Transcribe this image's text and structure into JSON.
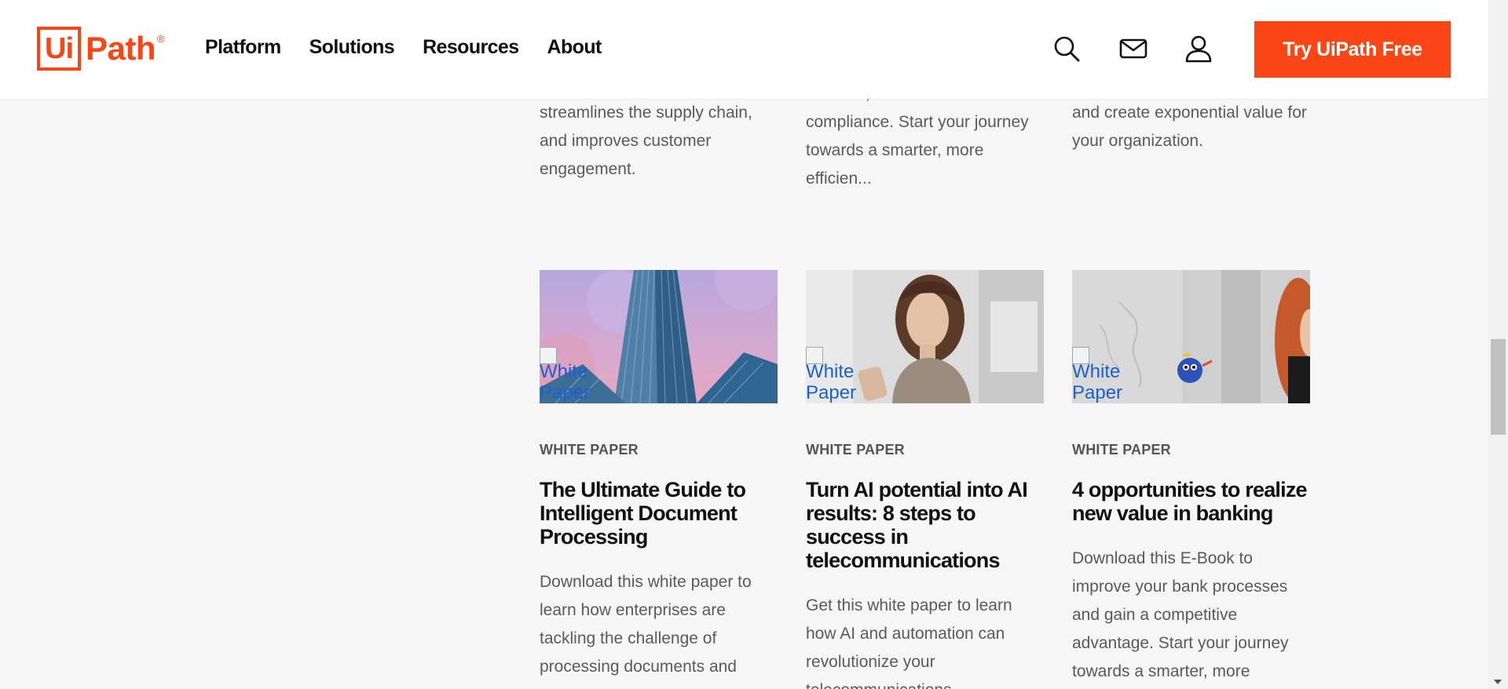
{
  "header": {
    "logo": {
      "brand": "Ui",
      "suffix": "Path",
      "reg": "®"
    },
    "nav": [
      "Platform",
      "Solutions",
      "Resources",
      "About"
    ],
    "icons": [
      "search-icon",
      "mail-icon",
      "user-icon"
    ],
    "cta_label": "Try UiPath Free"
  },
  "colors": {
    "accent": "#fa4616",
    "link": "#1a5fd0"
  },
  "top_texts": [
    "streamlines the supply chain, and improves customer engagement.",
    "revenue, and ensure compliance. Start your journey towards a smarter, more efficien...",
    "and create exponential value for your organization."
  ],
  "cards": [
    {
      "image_alt": "White Paper",
      "tag": "WHITE PAPER",
      "title": "The Ultimate Guide to Intelligent Document Processing",
      "description": "Download this white paper to learn how enterprises are tackling the challenge of processing documents and"
    },
    {
      "image_alt": "White Paper",
      "tag": "WHITE PAPER",
      "title": "Turn AI potential into AI results: 8 steps to success in telecommunications",
      "description": "Get this white paper to learn how AI and automation can revolutionize your telecommunications"
    },
    {
      "image_alt": "White Paper",
      "tag": "WHITE PAPER",
      "title": "4 opportunities to realize new value in banking",
      "description": "Download this E-Book to improve your bank processes and gain a competitive advantage. Start your journey towards a smarter, more"
    }
  ]
}
